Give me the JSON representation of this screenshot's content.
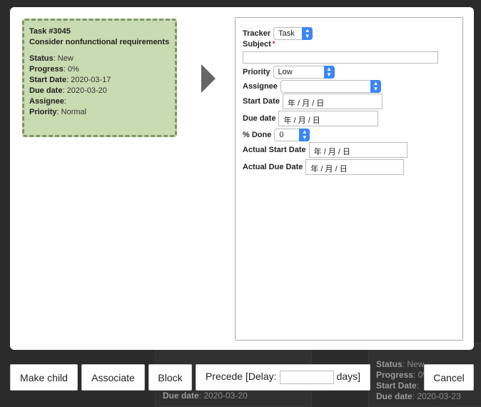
{
  "background": {
    "card_a": {
      "due_label": "Due date",
      "due_value": "2020-03-20"
    },
    "card_b": {
      "status_label": "Status",
      "status_value": "New",
      "progress_label": "Progress",
      "progress_value": "0%",
      "start_label": "Start Date",
      "due_label": "Due date",
      "due_value": "2020-03-23"
    }
  },
  "task_card": {
    "title": "Task #3045",
    "subject": "Consider nonfunctional requirements",
    "fields": [
      {
        "label": "Status",
        "value": "New"
      },
      {
        "label": "Progress",
        "value": "0%"
      },
      {
        "label": "Start Date",
        "value": "2020-03-17"
      },
      {
        "label": "Due date",
        "value": "2020-03-20"
      },
      {
        "label": "Assignee",
        "value": ""
      },
      {
        "label": "Priority",
        "value": "Normal"
      }
    ]
  },
  "form": {
    "tracker": {
      "label": "Tracker",
      "value": "Task"
    },
    "subject": {
      "label": "Subject",
      "required": "*",
      "value": ""
    },
    "priority": {
      "label": "Priority",
      "value": "Low"
    },
    "assignee": {
      "label": "Assignee",
      "value": ""
    },
    "start_date": {
      "label": "Start Date",
      "placeholder": "年 / 月 / 日"
    },
    "due_date": {
      "label": "Due date",
      "placeholder": "年 / 月 / 日"
    },
    "done": {
      "label": "% Done",
      "value": "0"
    },
    "actual_start": {
      "label": "Actual Start Date",
      "placeholder": "年 / 月 / 日"
    },
    "actual_due": {
      "label": "Actual Due Date",
      "placeholder": "年 / 月 / 日"
    }
  },
  "buttons": {
    "make_child": "Make child",
    "associate": "Associate",
    "block": "Block",
    "precede_prefix": "Precede [Delay:",
    "precede_suffix": "days]",
    "delay_value": "",
    "cancel": "Cancel"
  },
  "colors": {
    "card_bg": "#c9dbb0",
    "card_border": "#7e9566",
    "select_accent": "#3b86f7",
    "overlay": "#2b2b2b"
  }
}
